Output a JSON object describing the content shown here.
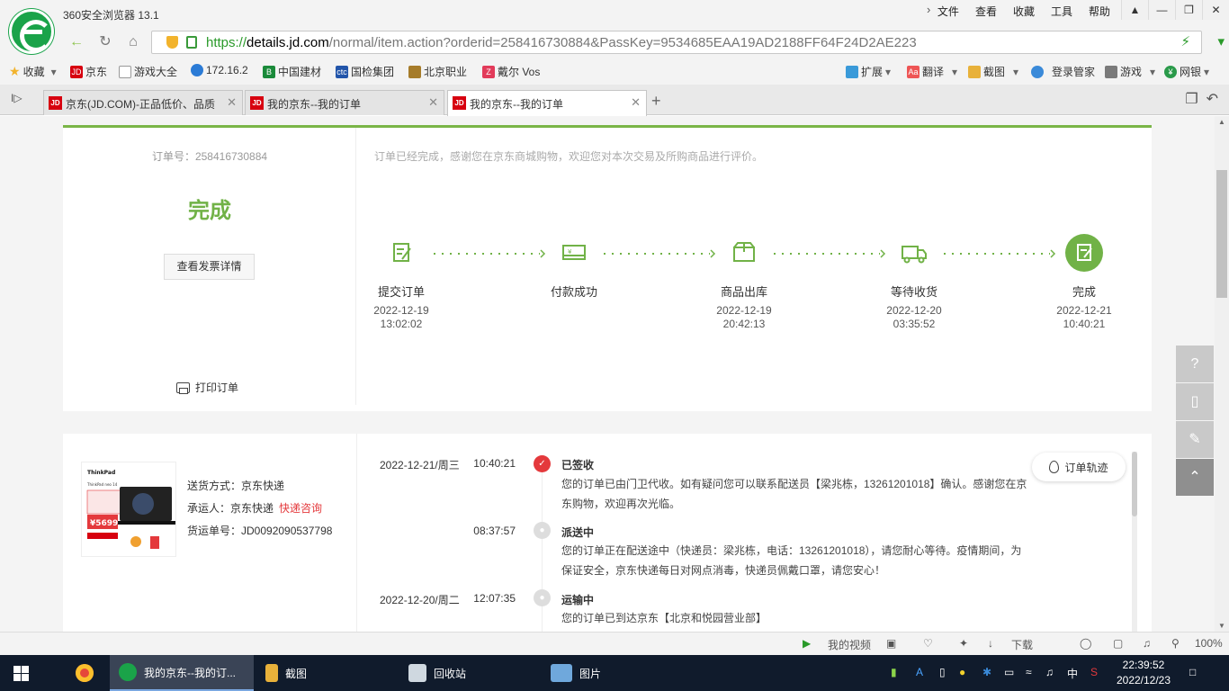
{
  "browser": {
    "app_title": "360安全浏览器 13.1",
    "menu": [
      "文件",
      "查看",
      "收藏",
      "工具",
      "帮助"
    ],
    "url_scheme": "https://",
    "url_host": "details.jd.com",
    "url_path": "/normal/item.action?orderid=258416730884&PassKey=9534685EAA19AD2188FF64F24D2AE223"
  },
  "bookmarks": {
    "left": [
      "收藏",
      "京东",
      "游戏大全",
      "172.16.2",
      "中国建材",
      "国检集团",
      "北京职业",
      "戴尔 Vos"
    ],
    "right": [
      "扩展",
      "翻译",
      "截图",
      "登录管家",
      "游戏",
      "网银"
    ]
  },
  "tabs": [
    {
      "label": "京东(JD.COM)-正品低价、品质",
      "icon": "JD"
    },
    {
      "label": "我的京东--我的订单",
      "icon": "JD"
    },
    {
      "label": "我的京东--我的订单",
      "icon": "JD"
    }
  ],
  "order": {
    "number_label": "订单号：258416730884",
    "status": "完成",
    "invoice_button": "查看发票详情",
    "print_label": "打印订单",
    "tip": "订单已经完成，感谢您在京东商城购物，欢迎您对本次交易及所购商品进行评价。"
  },
  "steps": [
    {
      "name": "提交订单",
      "date": "2022-12-19",
      "time": "13:02:02"
    },
    {
      "name": "付款成功",
      "date": "",
      "time": ""
    },
    {
      "name": "商品出库",
      "date": "2022-12-19",
      "time": "20:42:13"
    },
    {
      "name": "等待收货",
      "date": "2022-12-20",
      "time": "03:35:52"
    },
    {
      "name": "完成",
      "date": "2022-12-21",
      "time": "10:40:21"
    }
  ],
  "shipping": {
    "method": "送货方式：京东快递",
    "carrier_label": "承运人：京东快递",
    "consult_link": "快递咨询",
    "tracking_no": "货运单号：JD0092090537798",
    "product_brand": "ThinkPad",
    "product_model": "ThinkPad neo 14",
    "product_price": "¥5699"
  },
  "tracking": [
    {
      "date": "2022-12-21/周三",
      "time": "10:40:21",
      "title": "已签收",
      "desc": "您的订单已由门卫代收。如有疑问您可以联系配送员【梁兆栋，13261201018】确认。感谢您在京东购物，欢迎再次光临。"
    },
    {
      "date": "",
      "time": "08:37:57",
      "title": "派送中",
      "desc": "您的订单正在配送途中（快递员：梁兆栋，电话：13261201018），请您耐心等待。疫情期间，为保证安全，京东快递每日对网点消毒，快递员佩戴口罩，请您安心！"
    },
    {
      "date": "2022-12-20/周二",
      "time": "12:07:35",
      "title": "运输中",
      "desc": "您的订单已到达京东【北京和悦园营业部】"
    }
  ],
  "trail_button": "订单轨迹",
  "statusbar": {
    "video": "我的视频",
    "download": "下载",
    "zoom": "100%"
  },
  "taskbar": {
    "apps": [
      "我的京东--我的订...",
      "截图",
      "回收站",
      "图片"
    ],
    "ime": "中",
    "time": "22:39:52",
    "date": "2022/12/23"
  },
  "colors": {
    "accent_green": "#71b247",
    "jd_red": "#e4393c",
    "url_green": "#2a9a2a"
  }
}
